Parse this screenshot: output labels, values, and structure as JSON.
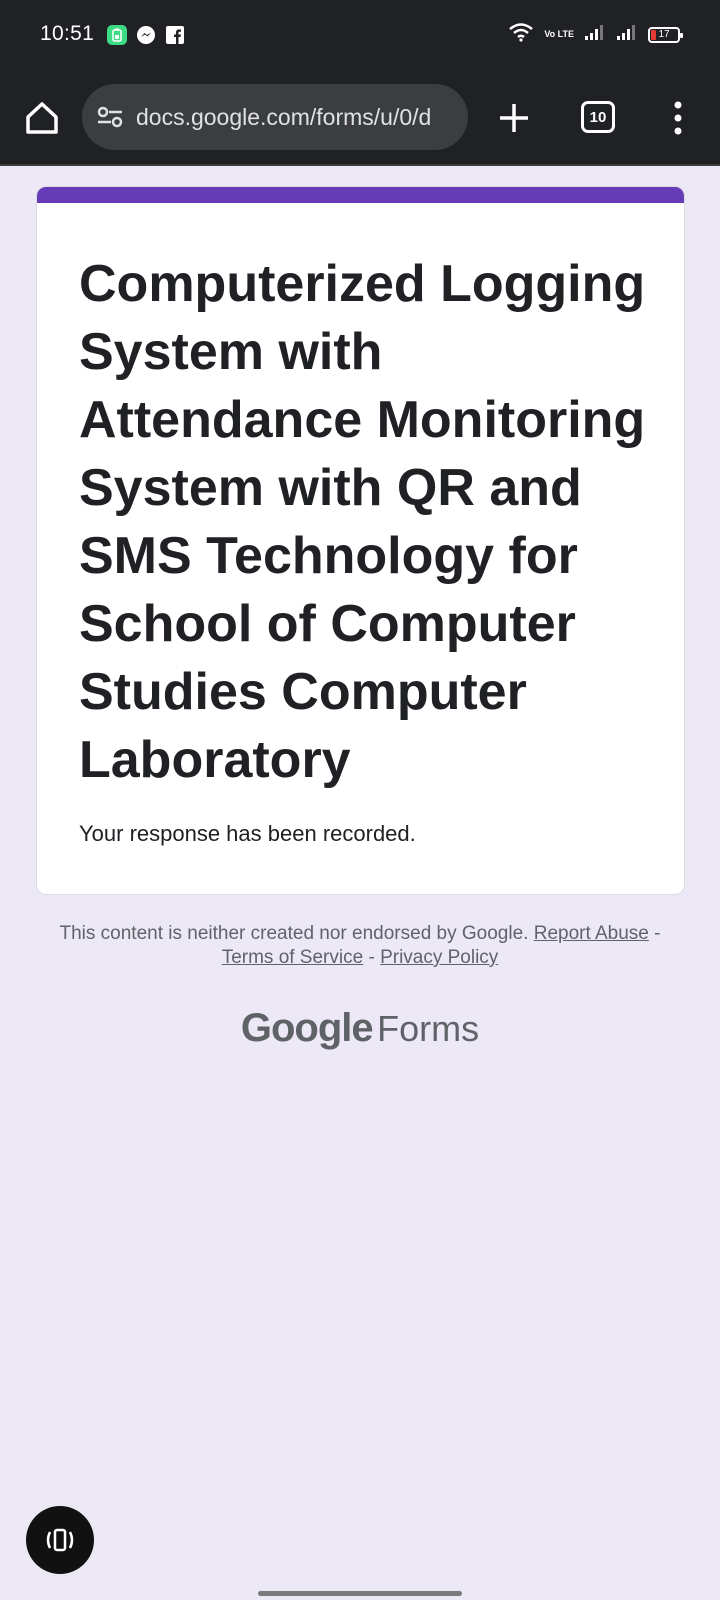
{
  "status_bar": {
    "time": "10:51",
    "notifications": [
      "battery-saver-icon",
      "messenger-icon",
      "facebook-icon"
    ],
    "network_label": "Vo LTE",
    "battery_level": "17"
  },
  "browser": {
    "url": "docs.google.com/forms/u/0/d",
    "tab_count": "10"
  },
  "form": {
    "accent_color": "#673ab7",
    "title": "Computerized Logging System with Attendance Monitoring System with QR and SMS Technology for School of Computer Studies Computer Laboratory",
    "confirmation": "Your response has been recorded."
  },
  "footer": {
    "disclaimer": "This content is neither created nor endorsed by Google.",
    "report_link": "Report Abuse",
    "separator": "-",
    "terms_link": "Terms of Service",
    "privacy_link": "Privacy Policy"
  },
  "brand": {
    "google": "Google",
    "forms": "Forms"
  }
}
